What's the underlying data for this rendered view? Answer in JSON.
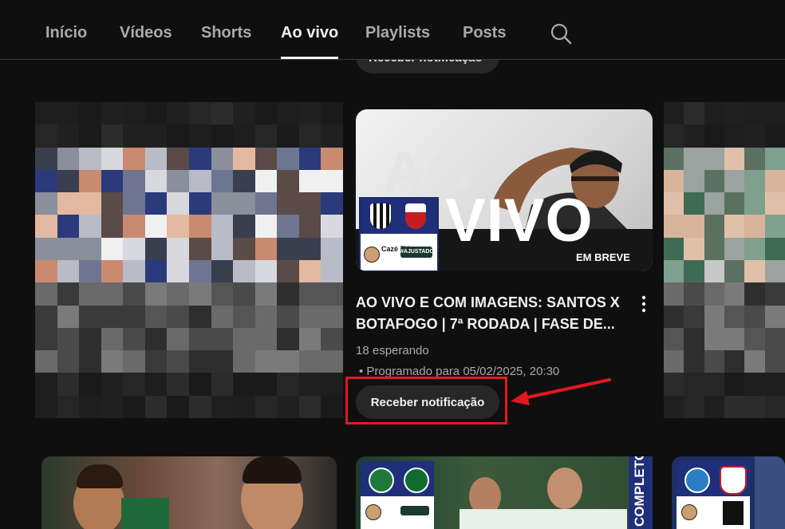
{
  "tabs": [
    {
      "label": "Início",
      "active": false
    },
    {
      "label": "Vídeos",
      "active": false
    },
    {
      "label": "Shorts",
      "active": false
    },
    {
      "label": "Ao vivo",
      "active": true
    },
    {
      "label": "Playlists",
      "active": false
    },
    {
      "label": "Posts",
      "active": false
    }
  ],
  "search_icon": "search-icon",
  "top_partial_button": {
    "label": "Receber notificação"
  },
  "main_card": {
    "thumbnail": {
      "headline_top": "AO",
      "headline_bottom": "VIVO",
      "badge": "EM BREVE",
      "channel_logo": "Cazé TV",
      "partner_badge": "#AJUSTADO"
    },
    "title_line1": "AO VIVO E COM IMAGENS: SANTOS X",
    "title_line2": "BOTAFOGO | 7ª RODADA | FASE DE...",
    "waiting": "18 esperando",
    "scheduled": "• Programado para 05/02/2025, 20:30",
    "notify_button": "Receber notificação",
    "menu_icon": "more-vert-icon"
  },
  "bottom_row": {
    "card2_side_label": "COMPLETO"
  },
  "colors": {
    "background": "#0f0f0f",
    "chip": "#272727",
    "text_primary": "#f1f1f1",
    "text_secondary": "#aaaaaa",
    "annotation_red": "#e3181f"
  }
}
